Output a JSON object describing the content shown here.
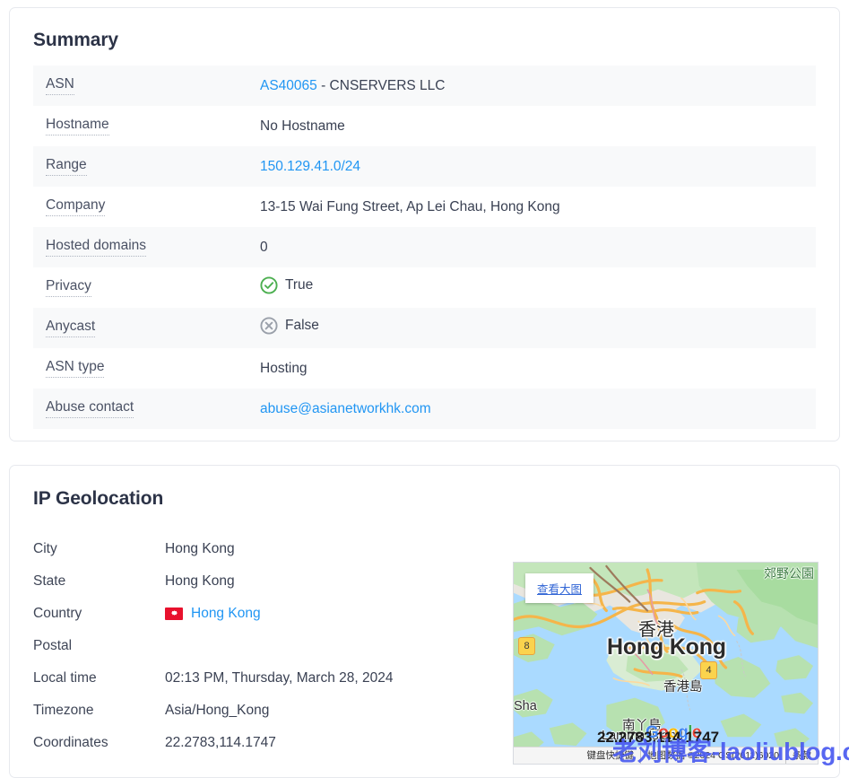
{
  "summary": {
    "title": "Summary",
    "rows": [
      {
        "label": "ASN",
        "link": "AS40065",
        "suffix": " - CNSERVERS LLC",
        "type": "link-suffix"
      },
      {
        "label": "Hostname",
        "value": "No Hostname",
        "type": "text"
      },
      {
        "label": "Range",
        "link": "150.129.41.0/24",
        "type": "link"
      },
      {
        "label": "Company",
        "value": "13-15 Wai Fung Street, Ap Lei Chau, Hong Kong",
        "type": "text"
      },
      {
        "label": "Hosted domains",
        "value": "0",
        "type": "text"
      },
      {
        "label": "Privacy",
        "value": "True",
        "type": "status-true",
        "icon": "check-circle-icon"
      },
      {
        "label": "Anycast",
        "value": "False",
        "type": "status-false",
        "icon": "x-circle-icon"
      },
      {
        "label": "ASN type",
        "value": "Hosting",
        "type": "text"
      },
      {
        "label": "Abuse contact",
        "link": "abuse@asianetworkhk.com",
        "type": "link"
      }
    ]
  },
  "geolocation": {
    "title": "IP Geolocation",
    "rows": [
      {
        "label": "City",
        "value": "Hong Kong"
      },
      {
        "label": "State",
        "value": "Hong Kong"
      },
      {
        "label": "Country",
        "value": "Hong Kong",
        "flag": "hong-kong-flag-icon",
        "is_link": true
      },
      {
        "label": "Postal",
        "value": ""
      },
      {
        "label": "Local time",
        "value": "02:13 PM, Thursday, March 28, 2024"
      },
      {
        "label": "Timezone",
        "value": "Asia/Hong_Kong"
      },
      {
        "label": "Coordinates",
        "value": "22.2783,114.1747"
      }
    ]
  },
  "map": {
    "view_larger_label": "查看大图",
    "park_label": "郊野公園",
    "city_cn": "香港",
    "city_en": "Hong Kong",
    "island_cn": "香港島",
    "sha_label": "Sha",
    "lamma_cn": "南丫島",
    "lamma_en": "Lamma Island",
    "shield_8": "8",
    "shield_4": "4",
    "logo": {
      "g1": "G",
      "o1": "o",
      "o2": "o",
      "g2": "g",
      "l": "l",
      "e": "e"
    },
    "attribution": {
      "shortcuts": "键盘快捷键",
      "data": "地图数据 ©2024 GS(2011)6020",
      "terms": "条款"
    }
  },
  "overlay": {
    "coordinates_bold": "22.2783,114.1747",
    "watermark": "老刘博客-laoliublog.cn"
  },
  "colors": {
    "link": "#2196f3",
    "status_true": "#4caf50",
    "status_false": "#9aa0aa",
    "heading": "#2c3347",
    "row_alt_bg": "#f8f9fa",
    "card_border": "#e7e9ee",
    "watermark": "#4a5bf0",
    "map_water": "#aadaff",
    "map_land": "#f2efe9",
    "map_green": "#b7e1b0",
    "map_road": "#f5b54a"
  }
}
